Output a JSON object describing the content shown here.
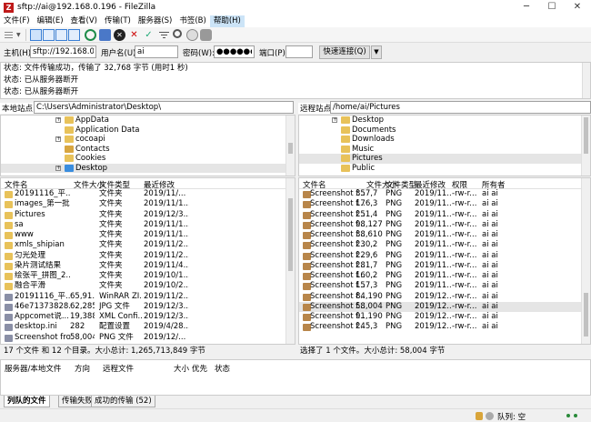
{
  "window": {
    "title": "sftp://ai@192.168.0.196 - FileZilla",
    "icon": "filezilla-icon",
    "controls": [
      "─",
      "☐",
      "✕"
    ]
  },
  "menu": [
    "文件(F)",
    "编辑(E)",
    "查看(V)",
    "传输(T)",
    "服务器(S)",
    "书签(B)",
    "帮助(H)"
  ],
  "quickconnect": {
    "host_label": "主机(H):",
    "host": "sftp://192.168.0.19",
    "user_label": "用户名(U):",
    "user": "ai",
    "pass_label": "密码(W):",
    "pass": "●●●●●●●",
    "port_label": "端口(P):",
    "port": "",
    "button": "快速连接(Q)",
    "dropdown": "▼"
  },
  "log": [
    "状态:  文件传输成功，传输了 32,768 字节 (用时1 秒)",
    "状态:  已从服务器断开",
    "状态:  已从服务器断开"
  ],
  "local": {
    "site_label": "本地站点:",
    "path": "C:\\Users\\Administrator\\Desktop\\",
    "tree": [
      {
        "name": "AppData",
        "expander": "+"
      },
      {
        "name": "Application Data",
        "expander": ""
      },
      {
        "name": "cocoapi",
        "expander": "+"
      },
      {
        "name": "Contacts",
        "expander": ""
      },
      {
        "name": "Cookies",
        "expander": ""
      },
      {
        "name": "Desktop",
        "expander": "+"
      }
    ],
    "headers": [
      "文件名",
      "文件大小",
      "文件类型",
      "最近修改"
    ],
    "files": [
      {
        "name": "20191116_平...",
        "size": "",
        "type": "文件夹",
        "modified": "2019/11/..."
      },
      {
        "name": "images_第一批",
        "size": "",
        "type": "文件夹",
        "modified": "2019/11/1..."
      },
      {
        "name": "Pictures",
        "size": "",
        "type": "文件夹",
        "modified": "2019/12/3..."
      },
      {
        "name": "sa",
        "size": "",
        "type": "文件夹",
        "modified": "2019/11/1..."
      },
      {
        "name": "www",
        "size": "",
        "type": "文件夹",
        "modified": "2019/11/1..."
      },
      {
        "name": "xmls_shipian",
        "size": "",
        "type": "文件夹",
        "modified": "2019/11/2..."
      },
      {
        "name": "匀光处理",
        "size": "",
        "type": "文件夹",
        "modified": "2019/11/2..."
      },
      {
        "name": "染片测试结果",
        "size": "",
        "type": "文件夹",
        "modified": "2019/11/4..."
      },
      {
        "name": "绘张平_拼图_2...",
        "size": "",
        "type": "文件夹",
        "modified": "2019/10/1..."
      },
      {
        "name": "融合平滑",
        "size": "",
        "type": "文件夹",
        "modified": "2019/10/2..."
      },
      {
        "name": "20191116_平...",
        "size": "65,91...",
        "type": "WinRAR ZI...",
        "modified": "2019/11/2..."
      },
      {
        "name": "46e71373828...",
        "size": "62,285",
        "type": "JPG 文件",
        "modified": "2019/12/3..."
      },
      {
        "name": "Appcomet说...",
        "size": "19,388",
        "type": "XML Confi...",
        "modified": "2019/12/3..."
      },
      {
        "name": "desktop.ini",
        "size": "282",
        "type": "配置设置",
        "modified": "2019/4/28..."
      },
      {
        "name": "Screenshot fro...",
        "size": "58,004",
        "type": "PNG 文件",
        "modified": "2019/12/..."
      }
    ],
    "status": "17 个文件 和 12 个目录。大小总计: 1,265,713,849 字节"
  },
  "remote": {
    "site_label": "远程站点:",
    "path": "/home/ai/Pictures",
    "tree": [
      {
        "name": "Desktop",
        "expander": "+"
      },
      {
        "name": "Documents",
        "expander": ""
      },
      {
        "name": "Downloads",
        "expander": ""
      },
      {
        "name": "Music",
        "expander": ""
      },
      {
        "name": "Pictures",
        "expander": ""
      },
      {
        "name": "Public",
        "expander": ""
      }
    ],
    "headers": [
      "文件名",
      "文件大小",
      "文件类型",
      "最近修改",
      "权限",
      "所有者"
    ],
    "files": [
      {
        "name": "Screenshot f...",
        "size": "357,7",
        "type": "PNG",
        "modified": "2019/11...",
        "perm": "-rw-r...",
        "owner": "ai ai"
      },
      {
        "name": "Screenshot f...",
        "size": "176,3",
        "type": "PNG",
        "modified": "2019/11...",
        "perm": "-rw-r...",
        "owner": "ai ai"
      },
      {
        "name": "Screenshot f...",
        "size": "251,4",
        "type": "PNG",
        "modified": "2019/11...",
        "perm": "-rw-r...",
        "owner": "ai ai"
      },
      {
        "name": "Screenshot f...",
        "size": "98,127",
        "type": "PNG",
        "modified": "2019/11...",
        "perm": "-rw-r...",
        "owner": "ai ai"
      },
      {
        "name": "Screenshot f...",
        "size": "38,610",
        "type": "PNG",
        "modified": "2019/11...",
        "perm": "-rw-r...",
        "owner": "ai ai"
      },
      {
        "name": "Screenshot f...",
        "size": "230,2",
        "type": "PNG",
        "modified": "2019/11...",
        "perm": "-rw-r...",
        "owner": "ai ai"
      },
      {
        "name": "Screenshot f...",
        "size": "229,6",
        "type": "PNG",
        "modified": "2019/11...",
        "perm": "-rw-r...",
        "owner": "ai ai"
      },
      {
        "name": "Screenshot f...",
        "size": "281,7",
        "type": "PNG",
        "modified": "2019/11...",
        "perm": "-rw-r...",
        "owner": "ai ai"
      },
      {
        "name": "Screenshot f...",
        "size": "160,2",
        "type": "PNG",
        "modified": "2019/11...",
        "perm": "-rw-r...",
        "owner": "ai ai"
      },
      {
        "name": "Screenshot f...",
        "size": "157,3",
        "type": "PNG",
        "modified": "2019/11...",
        "perm": "-rw-r...",
        "owner": "ai ai"
      },
      {
        "name": "Screenshot f...",
        "size": "84,190",
        "type": "PNG",
        "modified": "2019/12...",
        "perm": "-rw-r...",
        "owner": "ai ai"
      },
      {
        "name": "Screenshot f...",
        "size": "58,004",
        "type": "PNG",
        "modified": "2019/12...",
        "perm": "-rw-r...",
        "owner": "ai ai"
      },
      {
        "name": "Screenshot f...",
        "size": "91,190",
        "type": "PNG",
        "modified": "2019/12...",
        "perm": "-rw-r...",
        "owner": "ai ai"
      },
      {
        "name": "Screenshot f...",
        "size": "245,3",
        "type": "PNG",
        "modified": "2019/12...",
        "perm": "-rw-r...",
        "owner": "ai ai"
      }
    ],
    "selected_index": 11,
    "status": "选择了 1 个文件。大小总计: 58,004 字节"
  },
  "queue": {
    "headers": [
      "服务器/本地文件",
      "方向",
      "远程文件",
      "大小",
      "优先",
      "状态"
    ]
  },
  "tabs": [
    "列队的文件",
    "传输失败",
    "成功的传输 (52)"
  ],
  "statusbar": {
    "queue": "队列: 空"
  }
}
